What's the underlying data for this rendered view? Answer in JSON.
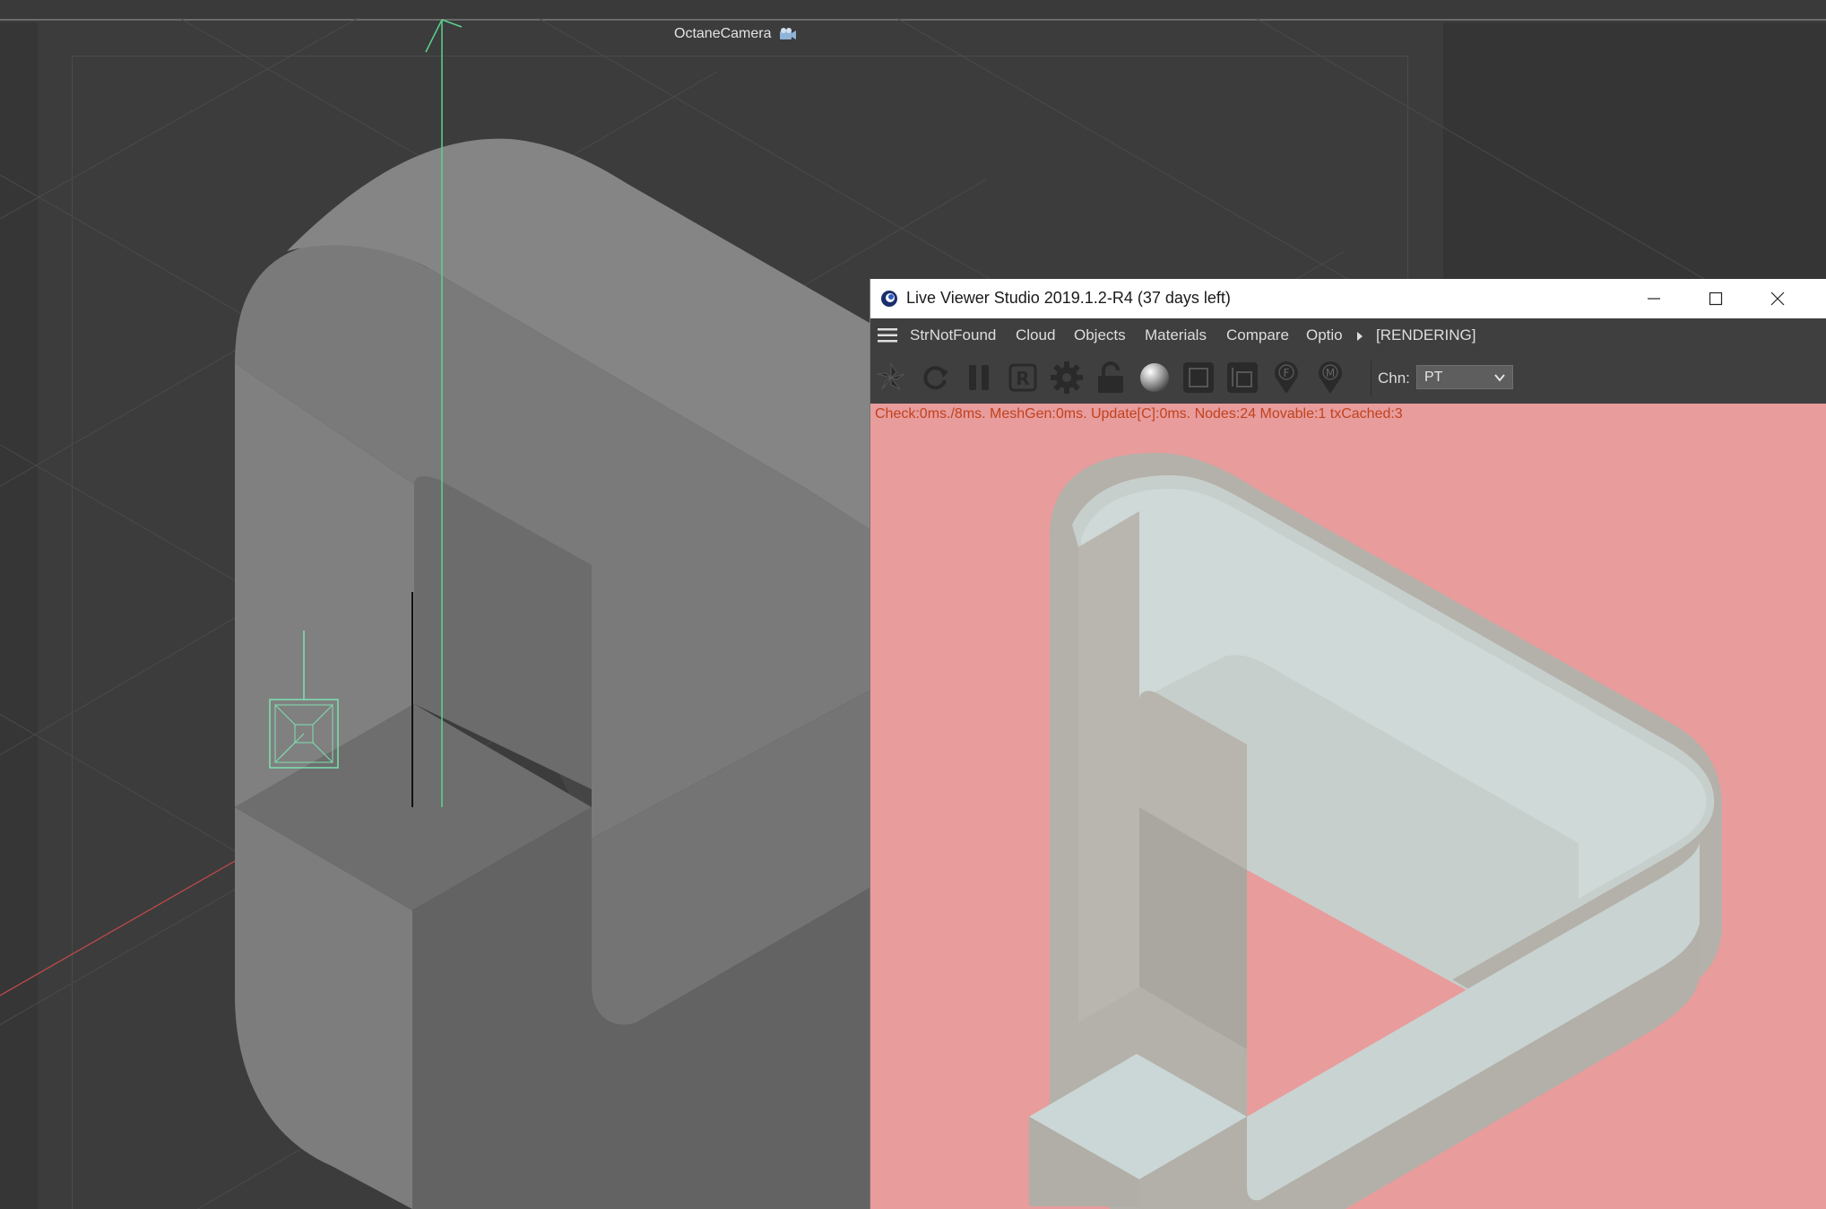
{
  "viewport": {
    "camera_label": "OctaneCamera",
    "camera_icon": "camera-icon"
  },
  "live_viewer": {
    "title": "Live Viewer Studio 2019.1.2-R4 (37 days left)",
    "app_icon": "octane-logo-icon",
    "window_buttons": {
      "minimize": "minimize-icon",
      "maximize": "maximize-icon",
      "close": "close-icon"
    },
    "menu": {
      "items": [
        "StrNotFound",
        "Cloud",
        "Objects",
        "Materials",
        "Compare",
        "Optio"
      ],
      "status": "[RENDERING]"
    },
    "toolbar": {
      "tools": [
        "aperture-icon",
        "refresh-icon",
        "pause-icon",
        "render-region-icon",
        "settings-gear-icon",
        "lock-icon",
        "material-ball-icon",
        "clay-mode-icon",
        "sub-sampling-icon",
        "focus-pick-icon",
        "material-pick-icon"
      ],
      "channel_label": "Chn:",
      "channel_value": "PT"
    },
    "stats": "Check:0ms./8ms.  MeshGen:0ms.  Update[C]:0ms.  Nodes:24  Movable:1  txCached:3"
  },
  "colors": {
    "render_background": "#e89c9c",
    "stats_text": "#c0421f",
    "viewport_background": "#3c3c3c"
  }
}
